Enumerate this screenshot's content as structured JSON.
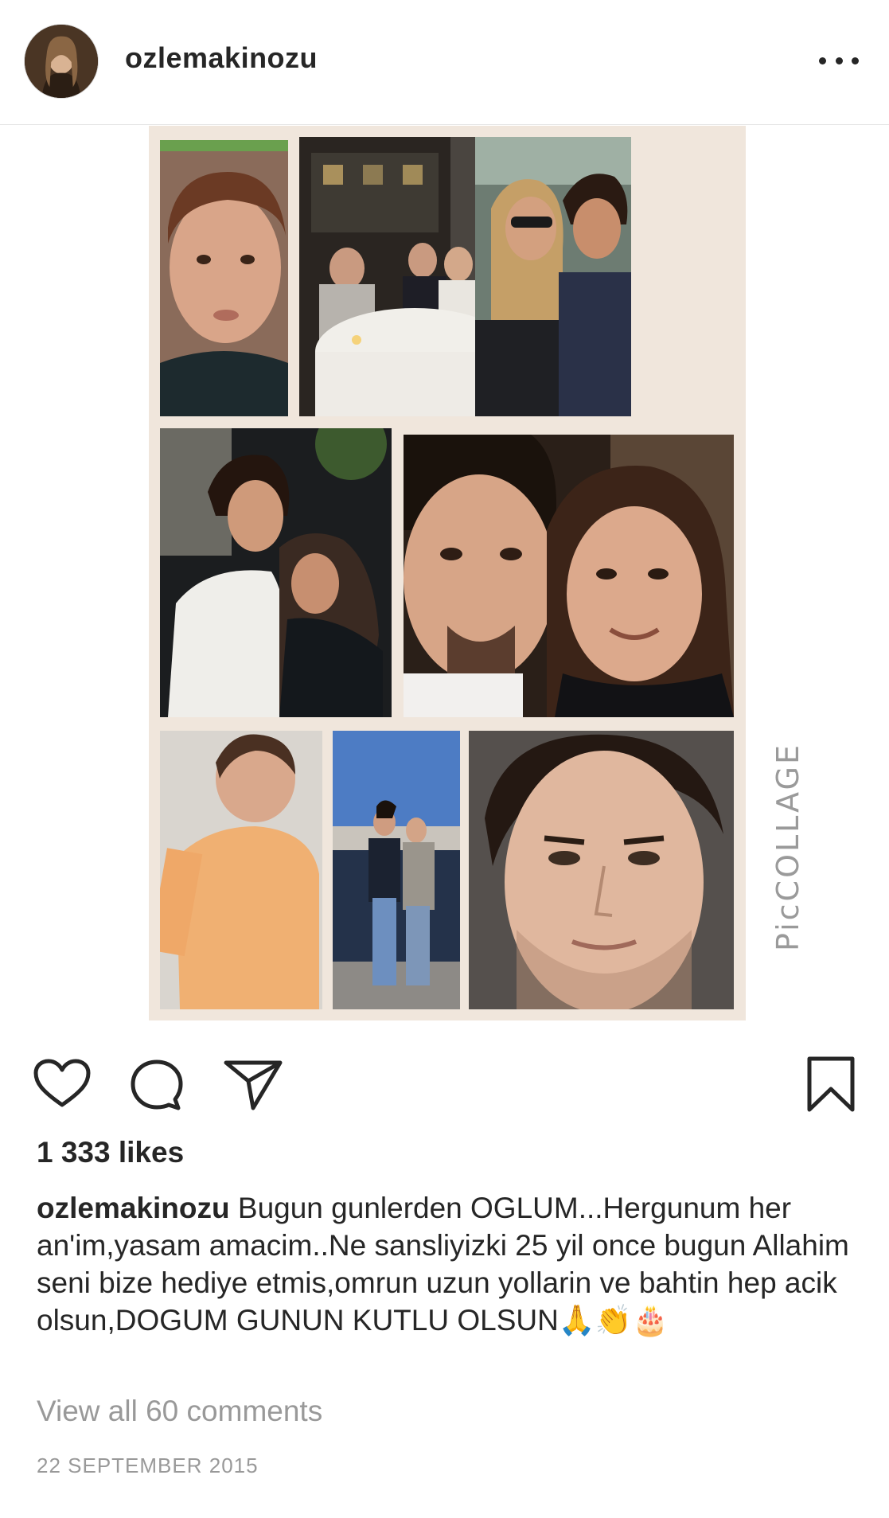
{
  "post": {
    "username": "ozlemakinozu",
    "likes": "1 333 likes",
    "caption_user": "ozlemakinozu",
    "caption_text": "Bugun gunlerden OGLUM...Hergunum her an'im,yasam amacim..Ne sansliyizki 25 yil once bugun Allahim seni bize hediye etmis,omrun uzun yollarin ve bahtin hep acik olsun,DOGUM GUNUN KUTLU OLSUN",
    "caption_emojis": "🙏👏🎂",
    "view_comments": "View all 60 comments",
    "timestamp": "22 SEPTEMBER 2015",
    "watermark": "PicCOLLAGE"
  },
  "colors": {
    "text": "#262626",
    "muted": "#999999",
    "collage_bg": "#f0e6dc"
  },
  "icons": {
    "more": "more-options-icon",
    "like": "heart-icon",
    "comment": "comment-bubble-icon",
    "share": "paper-plane-icon",
    "save": "bookmark-icon"
  }
}
